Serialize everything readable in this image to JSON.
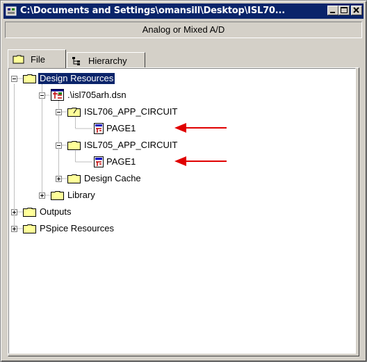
{
  "window": {
    "title": "C:\\Documents and Settings\\omansill\\Desktop\\ISL70...",
    "project_type": "Analog or Mixed A/D"
  },
  "tabs": [
    {
      "label": "File",
      "icon": "folder-icon",
      "active": true
    },
    {
      "label": "Hierarchy",
      "icon": "hierarchy-icon",
      "active": false
    }
  ],
  "tree": {
    "design_resources": "Design Resources",
    "design_file": ".\\isl705arh.dsn",
    "schematic_1": "ISL706_APP_CIRCUIT",
    "page_1": "PAGE1",
    "schematic_2": "ISL705_APP_CIRCUIT",
    "page_2": "PAGE1",
    "design_cache": "Design Cache",
    "library": "Library",
    "outputs": "Outputs",
    "pspice_resources": "PSpice Resources"
  },
  "colors": {
    "title_bar": "#0a246a",
    "selection": "#0a246a",
    "folder": "#ffff99",
    "annotation_arrow": "#e00000"
  }
}
